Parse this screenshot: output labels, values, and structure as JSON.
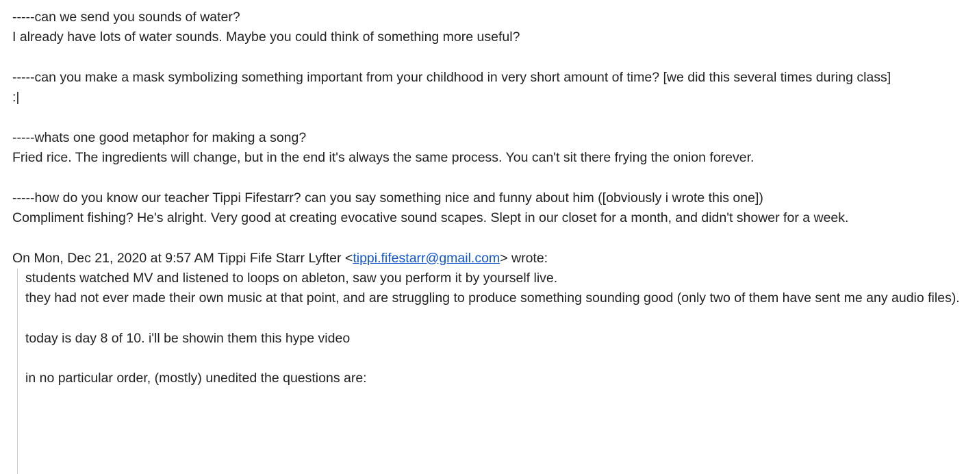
{
  "qa": [
    {
      "question": "-----can we send you sounds of water?",
      "answer": "I already have lots of water sounds. Maybe you could think of something more useful?"
    },
    {
      "question": "-----can you make a mask symbolizing something important from your childhood in very short amount of time? [we did this several times during class]",
      "answer": ":|"
    },
    {
      "question": "-----whats one good metaphor for making a song?",
      "answer": "Fried rice. The ingredients will change, but in the end it's always the same process. You can't sit there frying the onion forever."
    },
    {
      "question": "-----how do you know our teacher Tippi Fifestarr? can you say something nice and funny about him ([obviously i wrote this one])",
      "answer": "Compliment fishing? He's alright. Very good at creating evocative sound scapes. Slept in our closet for a month, and didn't shower for a week."
    }
  ],
  "attribution": {
    "prefix": "On Mon, Dec 21, 2020 at 9:57 AM Tippi Fife Starr Lyfter <",
    "email": "tippi.fifestarr@gmail.com",
    "suffix": "> wrote:"
  },
  "quoted": {
    "line1": "students watched MV and listened to loops on ableton, saw you perform it by yourself live.",
    "line2": "they had not ever made their own music at that point, and are struggling to produce something sounding good (only two of them have sent me any audio files).",
    "line3": "today is day 8 of 10. i'll be showin them this hype video",
    "line4": "in no particular order, (mostly) unedited the questions are:"
  },
  "colors": {
    "text": "#222222",
    "link": "#1155cc",
    "quote_border": "#cccccc"
  }
}
